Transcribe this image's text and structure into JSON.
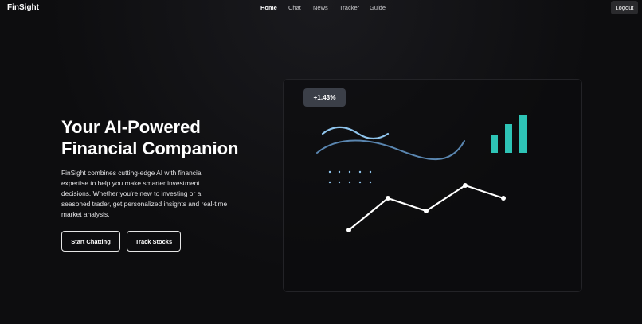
{
  "nav": {
    "brand": "FinSight",
    "links": [
      "Home",
      "Chat",
      "News",
      "Tracker",
      "Guide"
    ],
    "active": "Home",
    "logout_label": "Logout"
  },
  "hero": {
    "title_line1": "Your AI-Powered",
    "title_line2": "Financial Companion",
    "description": "FinSight combines cutting-edge AI with financial expertise to help you make smarter investment decisions. Whether you're new to investing or a seasoned trader, get personalized insights and real-time market analysis.",
    "primary_button": "Start Chatting",
    "secondary_button": "Track Stocks"
  },
  "illustration": {
    "badge_text": "+1.43%",
    "colors": {
      "accent_teal": "#2ec4b6",
      "wave_light": "#8fc4ec",
      "wave_dark": "#5a86b0",
      "line": "#ffffff"
    }
  }
}
